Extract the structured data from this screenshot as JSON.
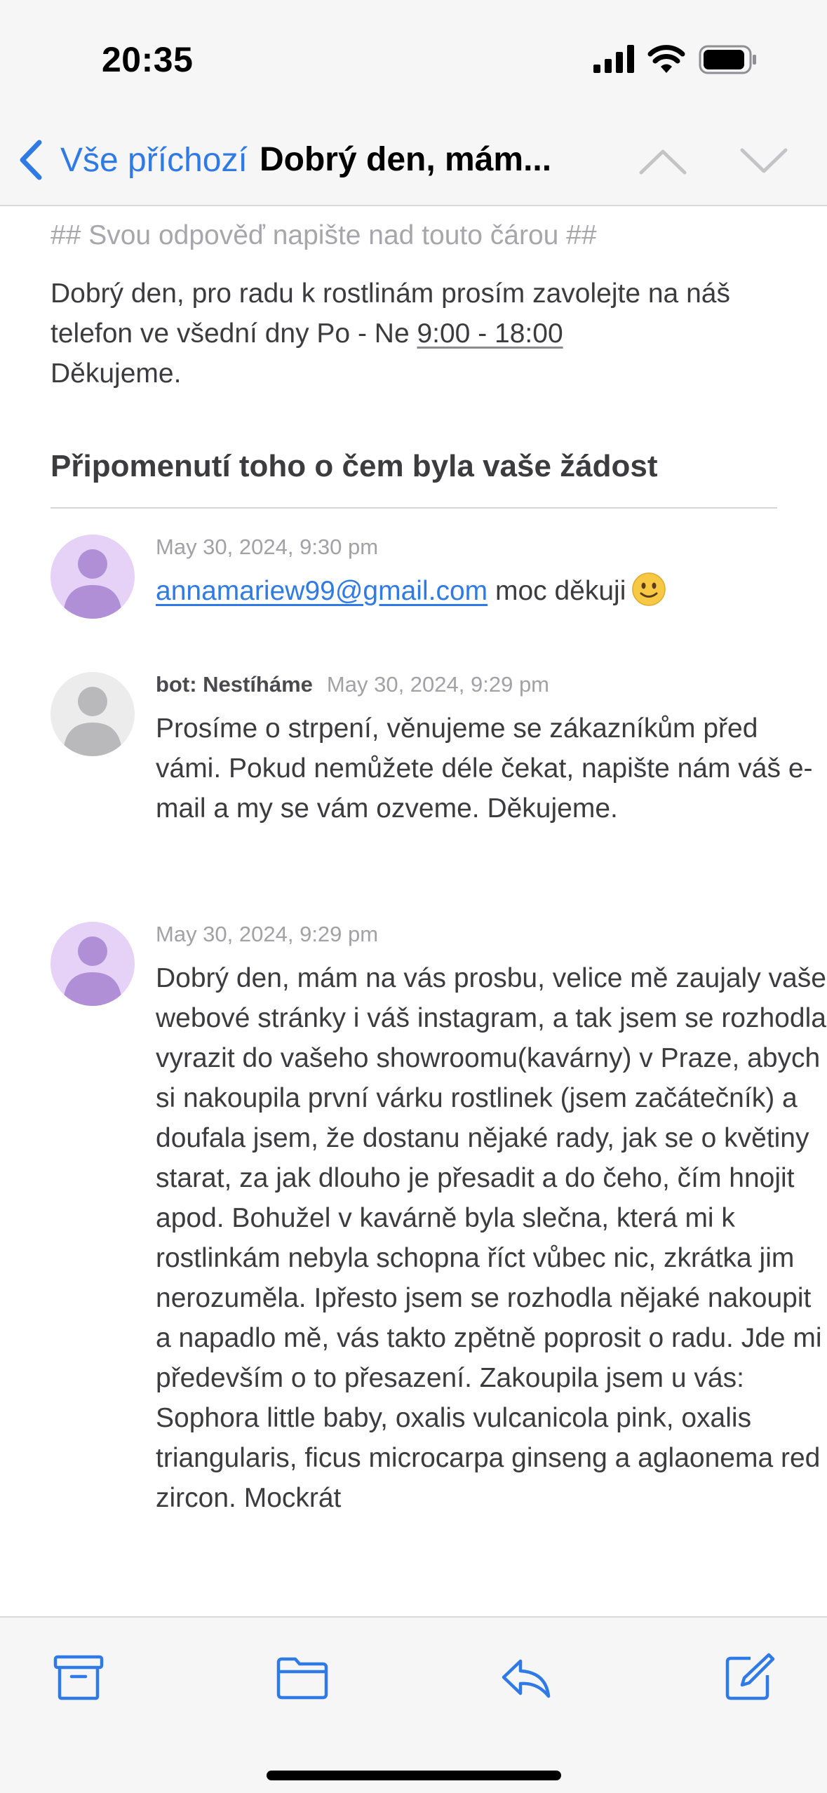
{
  "status_bar": {
    "time": "20:35"
  },
  "nav": {
    "back_label": "Vše příchozí",
    "title": "Dobrý den, mám..."
  },
  "email": {
    "separator_note": "## Svou odpověď napište nad touto čárou ##",
    "intro_text": "Dobrý den, pro radu k rostlinám prosím zavolejte na náš telefon ve všední dny Po - Ne ",
    "intro_hours": "9:00 - 18:00",
    "intro_thanks": "Děkujeme.",
    "section_heading": "Připomenutí toho o čem byla vaše žádost"
  },
  "messages": [
    {
      "timestamp": "May 30, 2024, 9:30 pm",
      "email_link": "annamariew99@gmail.com",
      "text": " moc děkuji"
    },
    {
      "sender": "bot: Nestíháme",
      "timestamp": "May 30, 2024, 9:29 pm",
      "text": "Prosíme o strpení, věnujeme se zákazníkům před vámi. Pokud nemůžete déle čekat, napište nám váš e-mail a my se vám ozveme. Děkujeme."
    },
    {
      "timestamp": "May 30, 2024, 9:29 pm",
      "text": "Dobrý den, mám na vás prosbu, velice mě zaujaly vaše webové stránky i váš instagram, a tak jsem se rozhodla vyrazit do vašeho showroomu(kavárny) v Praze, abych si nakoupila první várku rostlinek (jsem začátečník) a doufala jsem, že dostanu nějaké rady, jak se o květiny starat, za jak dlouho je přesadit a do čeho, čím hnojit apod. Bohužel v kavárně byla slečna, která mi k rostlinkám nebyla schopna říct vůbec nic, zkrátka jim nerozuměla. Ipřesto jsem se rozhodla nějaké nakoupit a napadlo mě, vás takto zpětně poprosit o radu. Jde mi především o to přesazení. Zakoupila jsem u vás: Sophora little baby, oxalis vulcanicola pink, oxalis triangularis, ficus microcarpa ginseng a aglaonema red zircon. Mockrát"
    }
  ],
  "colors": {
    "accent": "#2f7ae5",
    "user_avatar_bg": "#e6d2f7",
    "user_avatar_fg": "#b08fd6",
    "bot_avatar_bg": "#ececec",
    "bot_avatar_fg": "#b9b9bb"
  },
  "icons": {
    "toolbar": [
      "archive-icon",
      "folder-icon",
      "reply-icon",
      "compose-icon"
    ]
  }
}
